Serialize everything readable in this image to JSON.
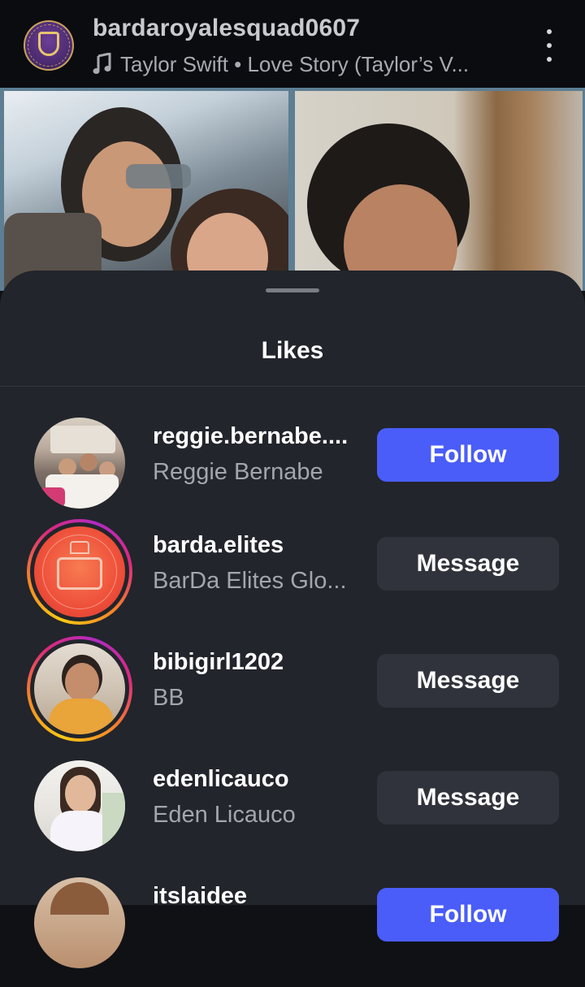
{
  "post": {
    "username": "bardaroyalesquad0607",
    "music": "Taylor Swift • Love Story (Taylor’s V..."
  },
  "sheet": {
    "title": "Likes"
  },
  "likes": [
    {
      "username": "reggie.bernabe....",
      "full_name": "Reggie Bernabe",
      "action": "Follow",
      "has_story": false
    },
    {
      "username": "barda.elites",
      "full_name": "BarDa Elites Glo...",
      "action": "Message",
      "has_story": true
    },
    {
      "username": "bibigirl1202",
      "full_name": "BB",
      "action": "Message",
      "has_story": true
    },
    {
      "username": "edenlicauco",
      "full_name": "Eden Licauco",
      "action": "Message",
      "has_story": false
    },
    {
      "username": "itslaidee",
      "full_name": "",
      "action": "Follow",
      "has_story": false
    }
  ],
  "colors": {
    "follow_button": "#4a5df9",
    "message_button": "#30333b",
    "sheet_background": "#22252b"
  },
  "icons": {
    "music": "music-note-icon",
    "more": "more-vertical-icon"
  }
}
